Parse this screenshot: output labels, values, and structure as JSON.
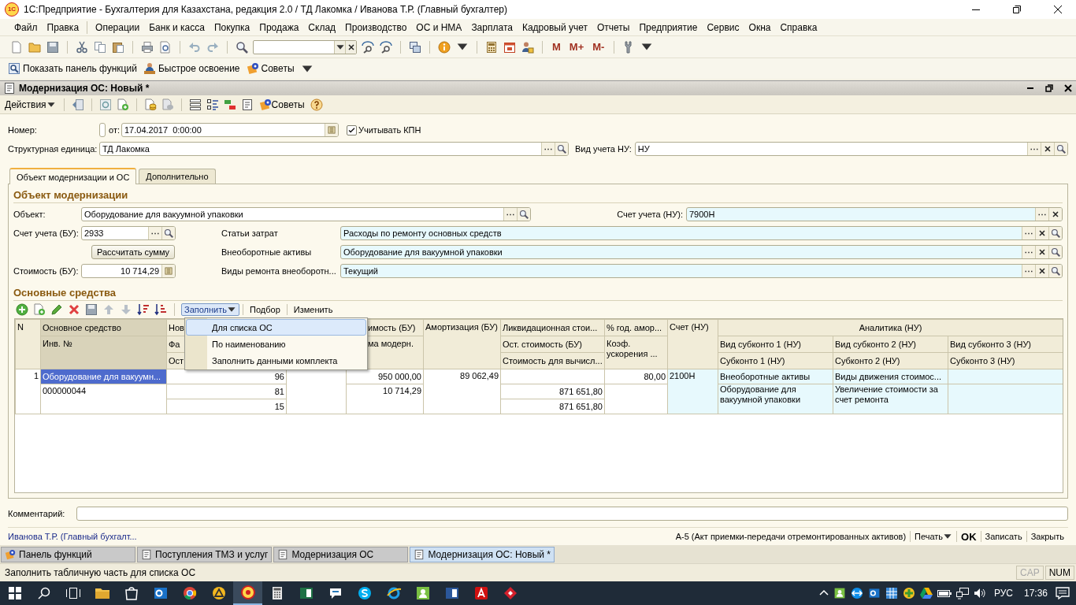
{
  "window": {
    "logo": "1С",
    "title": "1С:Предприятие - Бухгалтерия для Казахстана, редакция 2.0 / ТД Лакомка / Иванова Т.Р. (Главный бухгалтер)"
  },
  "menu": [
    "Файл",
    "Правка",
    "Операции",
    "Банк и касса",
    "Покупка",
    "Продажа",
    "Склад",
    "Производство",
    "ОС и НМА",
    "Зарплата",
    "Кадровый учет",
    "Отчеты",
    "Предприятие",
    "Сервис",
    "Окна",
    "Справка"
  ],
  "toolbar": {
    "memory_buttons": [
      "M",
      "M+",
      "M-"
    ]
  },
  "function_bar": [
    "Показать панель функций",
    "Быстрое освоение",
    "Советы"
  ],
  "document": {
    "title": "Модернизация ОС: Новый *",
    "toolbar": {
      "actions": "Действия",
      "tips": "Советы"
    },
    "number": {
      "label": "Номер:"
    },
    "date": {
      "label": "от:",
      "value": "17.04.2017  0:00:00"
    },
    "kpn": {
      "label": "Учитывать КПН",
      "checked": true
    },
    "unit": {
      "label": "Структурная единица:",
      "value": "ТД Лакомка"
    },
    "tax_view": {
      "label": "Вид учета НУ:",
      "value": "НУ"
    },
    "tabs": [
      {
        "label": "Объект модернизации и ОС",
        "selected": true
      },
      {
        "label": "Дополнительно",
        "selected": false
      }
    ],
    "object_section": {
      "title": "Объект модернизации",
      "object": {
        "label": "Объект:",
        "value": "Оборудование для вакуумной упаковки"
      },
      "tax_account": {
        "label": "Счет учета (НУ):",
        "value": "7900Н"
      },
      "account": {
        "label": "Счет учета (БУ):",
        "value": "2933"
      },
      "calc_button": "Рассчитать сумму",
      "cost": {
        "label": "Стоимость (БУ):",
        "value": "10 714,29"
      },
      "expense": {
        "label": "Статьи затрат",
        "value": "Расходы по ремонту основных средств"
      },
      "assets": {
        "label": "Внеоборотные активы",
        "value": "Оборудование для вакуумной упаковки"
      },
      "repair": {
        "label": "Виды ремонта внеоборотн...",
        "value": "Текущий"
      }
    },
    "assets_section": {
      "title": "Основные средства",
      "fill_button": {
        "label": "Заполнить",
        "expanded": true
      },
      "pick_button": "Подбор",
      "change_button": "Изменить",
      "fill_menu": [
        {
          "label": "Для списка ОС",
          "selected": true
        },
        {
          "label": "По наименованию",
          "selected": false
        },
        {
          "label": "Заполнить данными комплекта",
          "selected": false
        }
      ],
      "table": {
        "columns": [
          {
            "title": "N"
          },
          {
            "title": "Основное средство",
            "sub": "Инв. №"
          },
          {
            "title": "Нов",
            "sub": "Фа",
            "sub2": "Ост"
          },
          {
            "kind": "covered"
          },
          {
            "title": "имость (БУ)",
            "sub": "ма модерн."
          },
          {
            "title": "Амортизация (БУ)"
          },
          {
            "title": "Ликвидационная стои...",
            "sub": "Ост. стоимость (БУ)",
            "sub2": "Стоимость для вычисл..."
          },
          {
            "title": "% год. амор...",
            "sub": "Коэф. ускорения ..."
          },
          {
            "title": "Счет (НУ)"
          }
        ],
        "group": {
          "title": "Аналитика (НУ)",
          "columns": [
            {
              "sub": "Вид субконто 1 (НУ)",
              "sub2": "Субконто 1 (НУ)"
            },
            {
              "sub": "Вид субконто 2 (НУ)",
              "sub2": "Субконто 2 (НУ)"
            },
            {
              "sub": "Вид субконто 3 (НУ)",
              "sub2": "Субконто 3 (НУ)"
            }
          ]
        },
        "rows": [
          {
            "n": "1",
            "asset": "Оборудование для вакуумн...",
            "asset_selected": true,
            "inv": "000000044",
            "quantities": [
              "96",
              "81",
              "15"
            ],
            "cost": "950 000,00",
            "modernization": "10 714,29",
            "depreciation": "89 062,49",
            "residual": [
              "871 651,80",
              "871 651,80"
            ],
            "rate": "80,00",
            "account": "2100Н",
            "analytics": [
              {
                "type": "Внеоборотные активы",
                "value": "Оборудование для вакуумной упаковки"
              },
              {
                "type": "Виды движения стоимос...",
                "value": "Увеличение стоимости за счет ремонта"
              }
            ]
          }
        ]
      }
    },
    "comment": {
      "label": "Комментарий:"
    },
    "footer": {
      "author": "Иванова Т.Р. (Главный бухгалт...",
      "print_form": "А-5 (Акт приемки-передачи отремонтированных активов)",
      "print": "Печать",
      "ok": "OK",
      "save": "Записать",
      "close": "Закрыть"
    }
  },
  "window_tabs": [
    {
      "label": "Панель функций",
      "selected": false
    },
    {
      "label": "Поступления ТМЗ и услуг",
      "selected": false
    },
    {
      "label": "Модернизация ОС",
      "selected": false
    },
    {
      "label": "Модернизация ОС: Новый *",
      "selected": true
    }
  ],
  "status_bar": {
    "text": "Заполнить табличную часть для списка ОС",
    "indicators": [
      {
        "label": "CAP",
        "on": false
      },
      {
        "label": "NUM",
        "on": true
      }
    ]
  },
  "taskbar": {
    "apps": [
      {
        "kind": "folder",
        "active": false
      },
      {
        "kind": "store",
        "active": false
      },
      {
        "kind": "mail",
        "active": false
      },
      {
        "kind": "browser",
        "active": false
      },
      {
        "kind": "triangle",
        "active": false
      },
      {
        "kind": "onec",
        "active": true
      },
      {
        "kind": "calculator",
        "active": false
      },
      {
        "kind": "sheet",
        "active": false
      },
      {
        "kind": "chat",
        "active": false
      },
      {
        "kind": "skype",
        "active": false
      },
      {
        "kind": "globe",
        "active": false
      },
      {
        "kind": "person",
        "active": false
      },
      {
        "kind": "doc",
        "active": false
      },
      {
        "kind": "acrobat",
        "active": false
      },
      {
        "kind": "diamond",
        "active": false
      }
    ],
    "language": "РУС",
    "time": "17:36"
  }
}
